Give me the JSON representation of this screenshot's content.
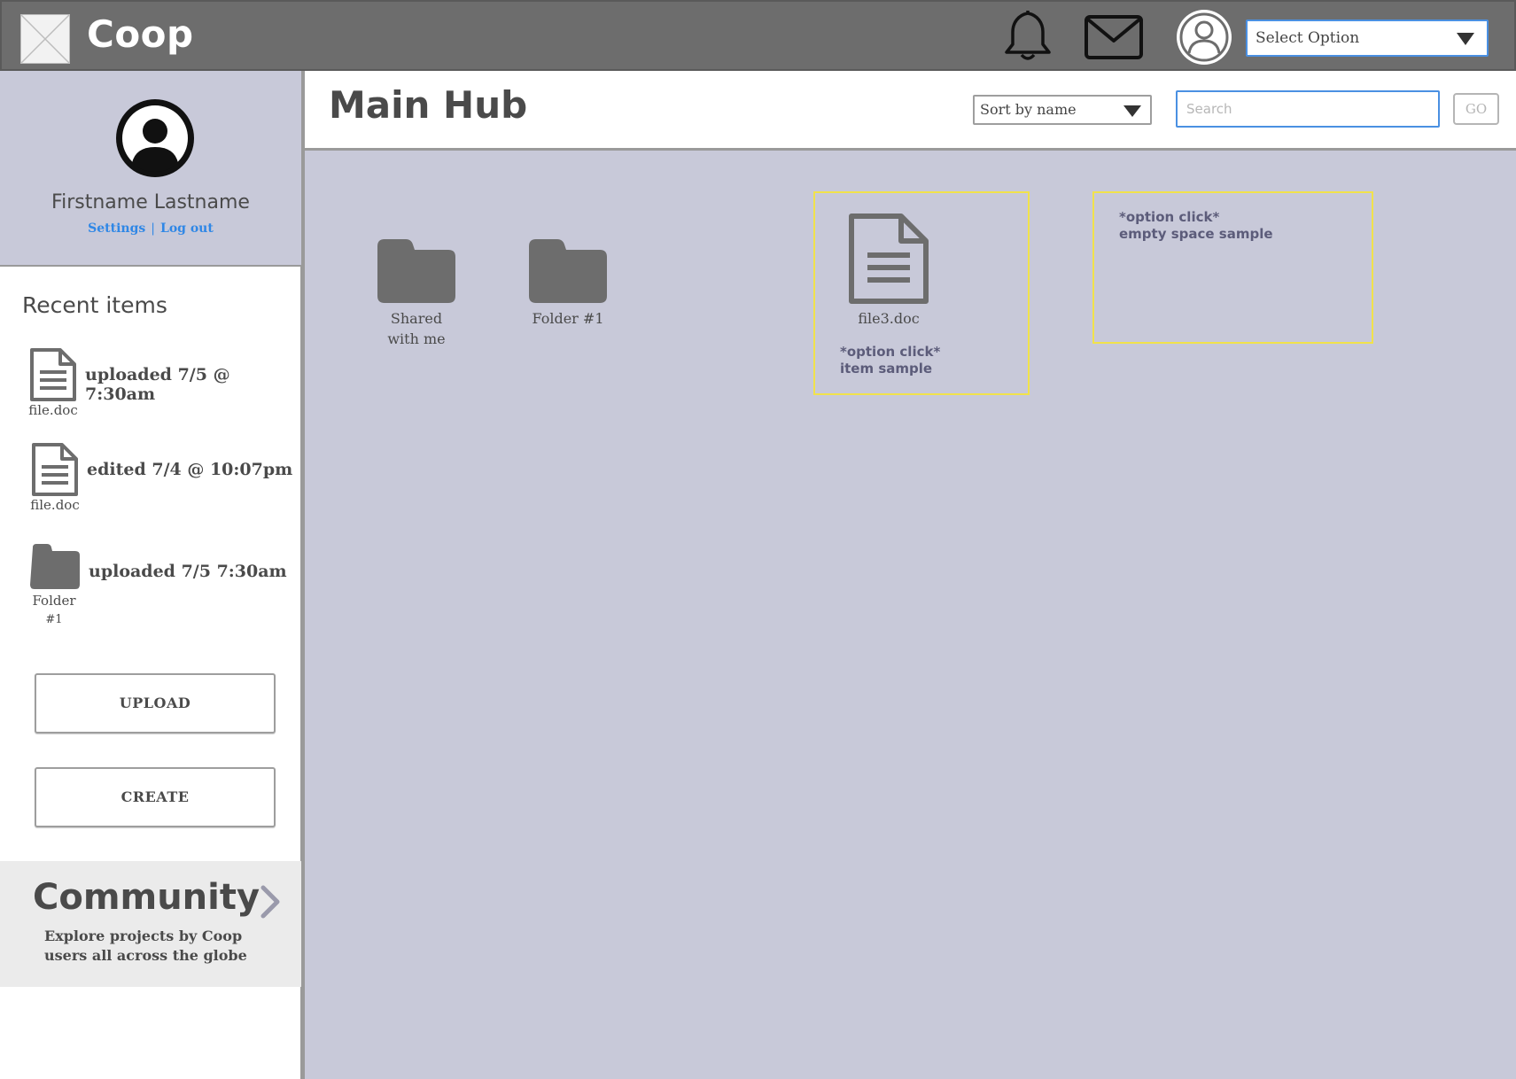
{
  "header": {
    "app_name": "Coop",
    "select_option": "Select Option"
  },
  "icons": {
    "logo": "image-placeholder-icon",
    "notifications": "bell-icon",
    "messages": "mail-icon",
    "account": "user-avatar-icon"
  },
  "profile": {
    "name": "Firstname Lastname",
    "settings_label": "Settings",
    "separator": "|",
    "logout_label": "Log out"
  },
  "recent": {
    "title": "Recent items",
    "items": [
      {
        "name": "file.doc",
        "type": "document",
        "desc": "uploaded 7/5 @ 7:30am"
      },
      {
        "name": "file.doc",
        "type": "document",
        "desc": "edited 7/4 @ 10:07pm"
      },
      {
        "name": "Folder",
        "name_suffix": "#1",
        "type": "folder",
        "desc": "uploaded 7/5 7:30am"
      }
    ]
  },
  "actions": {
    "upload_label": "UPLOAD",
    "create_label": "CREATE"
  },
  "community": {
    "title": "Community",
    "description": "Explore projects by Coop users all across the globe"
  },
  "main": {
    "title": "Main Hub",
    "sort_label": "Sort by name",
    "search_placeholder": "Search",
    "go_label": "GO",
    "folders": [
      {
        "line1": "Shared",
        "line2": "with me"
      },
      {
        "line1": "Folder #1",
        "line2": ""
      }
    ],
    "file": {
      "name": "file3.doc"
    },
    "item_sample_note": "*option click*\nitem sample",
    "empty_sample_note": "*option click*\nempty space sample"
  },
  "colors": {
    "topbar": "#6d6d6d",
    "profile_bg": "#c8c9d9",
    "canvas_bg": "#c8c9d9",
    "link": "#2f87e6",
    "accent_border": "#4a90e2",
    "sample_outline": "#f1e24b",
    "icon_gray": "#6d6d6d"
  }
}
